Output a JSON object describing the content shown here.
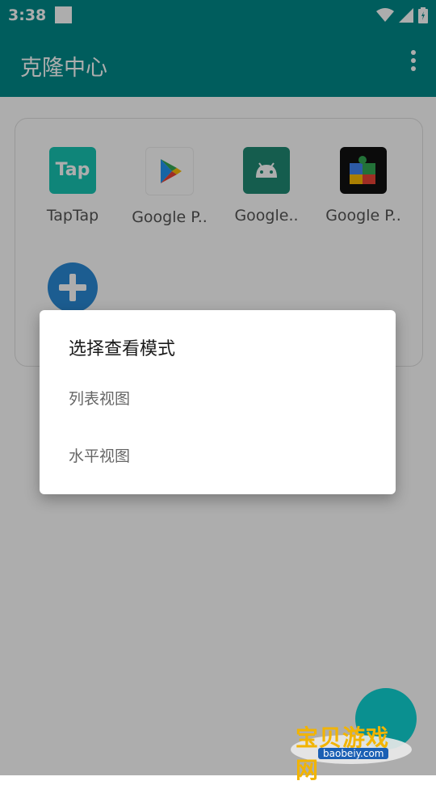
{
  "status_bar": {
    "time": "3:38"
  },
  "app_bar": {
    "title": "克隆中心"
  },
  "apps": [
    {
      "label": "TapTap",
      "icon": "taptap-icon",
      "icon_text": "Tap"
    },
    {
      "label": "Google P..",
      "icon": "google-play-store-icon"
    },
    {
      "label": "Google..",
      "icon": "android-app-icon"
    },
    {
      "label": "Google P..",
      "icon": "google-play-services-icon"
    }
  ],
  "dialog": {
    "title": "选择查看模式",
    "options": [
      "列表视图",
      "水平视图"
    ]
  },
  "watermark": {
    "brand": "宝贝游戏网",
    "url": "baobeiy.com"
  },
  "colors": {
    "primary": "#008a8a",
    "accent": "#2a8ad6"
  }
}
